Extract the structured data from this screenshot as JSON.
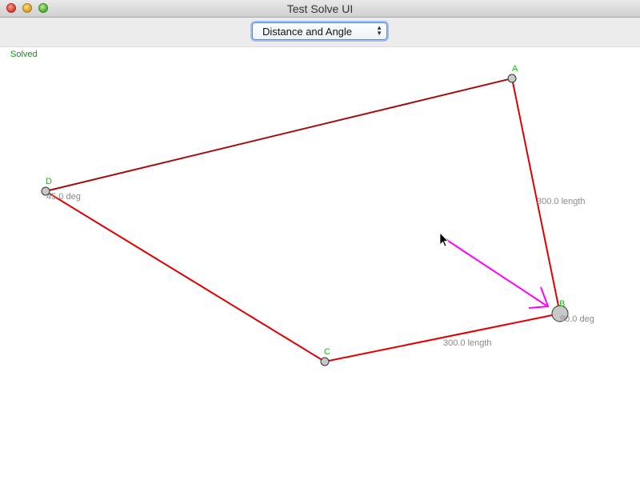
{
  "window": {
    "title": "Test Solve UI"
  },
  "toolbar": {
    "mode_select": {
      "selected": "Distance and Angle"
    }
  },
  "status": {
    "text": "Solved"
  },
  "points": {
    "A": {
      "label": "A"
    },
    "B": {
      "label": "B"
    },
    "C": {
      "label": "C"
    },
    "D": {
      "label": "D"
    }
  },
  "constraints": {
    "ab_length": "300.0 length",
    "bc_length": "300.0 length",
    "b_angle": "90.0 deg",
    "d_angle": "45.0 deg"
  },
  "colors": {
    "edge": "#e00000",
    "edge_ad": "#a01010",
    "drag_arrow": "#ff00ff",
    "point_fill": "#c8c8c8",
    "status_green": "#1a8a1a"
  }
}
